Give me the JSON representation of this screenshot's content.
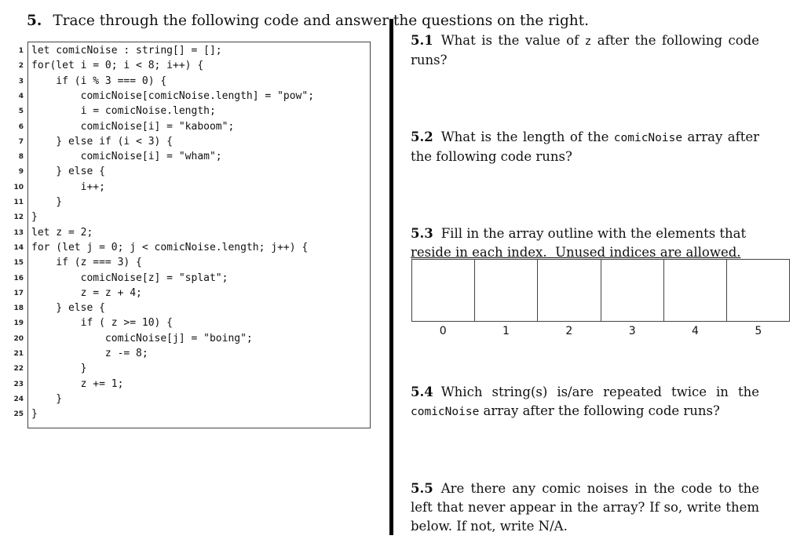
{
  "heading": {
    "number": "5.",
    "text": "Trace through the following code and answer the questions on the right."
  },
  "code_lines": [
    "let comicNoise : string[] = [];",
    "for(let i = 0; i < 8; i++) {",
    "    if (i % 3 === 0) {",
    "        comicNoise[comicNoise.length] = \"pow\";",
    "        i = comicNoise.length;",
    "        comicNoise[i] = \"kaboom\";",
    "    } else if (i < 3) {",
    "        comicNoise[i] = \"wham\";",
    "    } else {",
    "        i++;",
    "    }",
    "}",
    "let z = 2;",
    "for (let j = 0; j < comicNoise.length; j++) {",
    "    if (z === 3) {",
    "        comicNoise[z] = \"splat\";",
    "        z = z + 4;",
    "    } else {",
    "        if ( z >= 10) {",
    "            comicNoise[j] = \"boing\";",
    "            z -= 8;",
    "        }",
    "        z += 1;",
    "    }",
    "}"
  ],
  "questions": {
    "q1": {
      "num": "5.1",
      "pre": "What is the value of ",
      "code": "z",
      "post": " after the following code runs?"
    },
    "q2": {
      "num": "5.2",
      "pre": "What is the length of the ",
      "code": "comicNoise",
      "post": " array after the following code runs?"
    },
    "q3": {
      "num": "5.3",
      "line1": "Fill in the array outline with the elements that",
      "line2": "reside in each index.  Unused indices are allowed."
    },
    "q4": {
      "num": "5.4",
      "pre": "Which string(s) is/are repeated twice in the ",
      "code": "comicNoise",
      "post": " array after the following code runs?"
    },
    "q5": {
      "num": "5.5",
      "text": "Are there any comic noises in the code to the left that never appear in the array? If so, write them below. If not, write N/A."
    }
  },
  "array_indices": [
    "0",
    "1",
    "2",
    "3",
    "4",
    "5"
  ]
}
